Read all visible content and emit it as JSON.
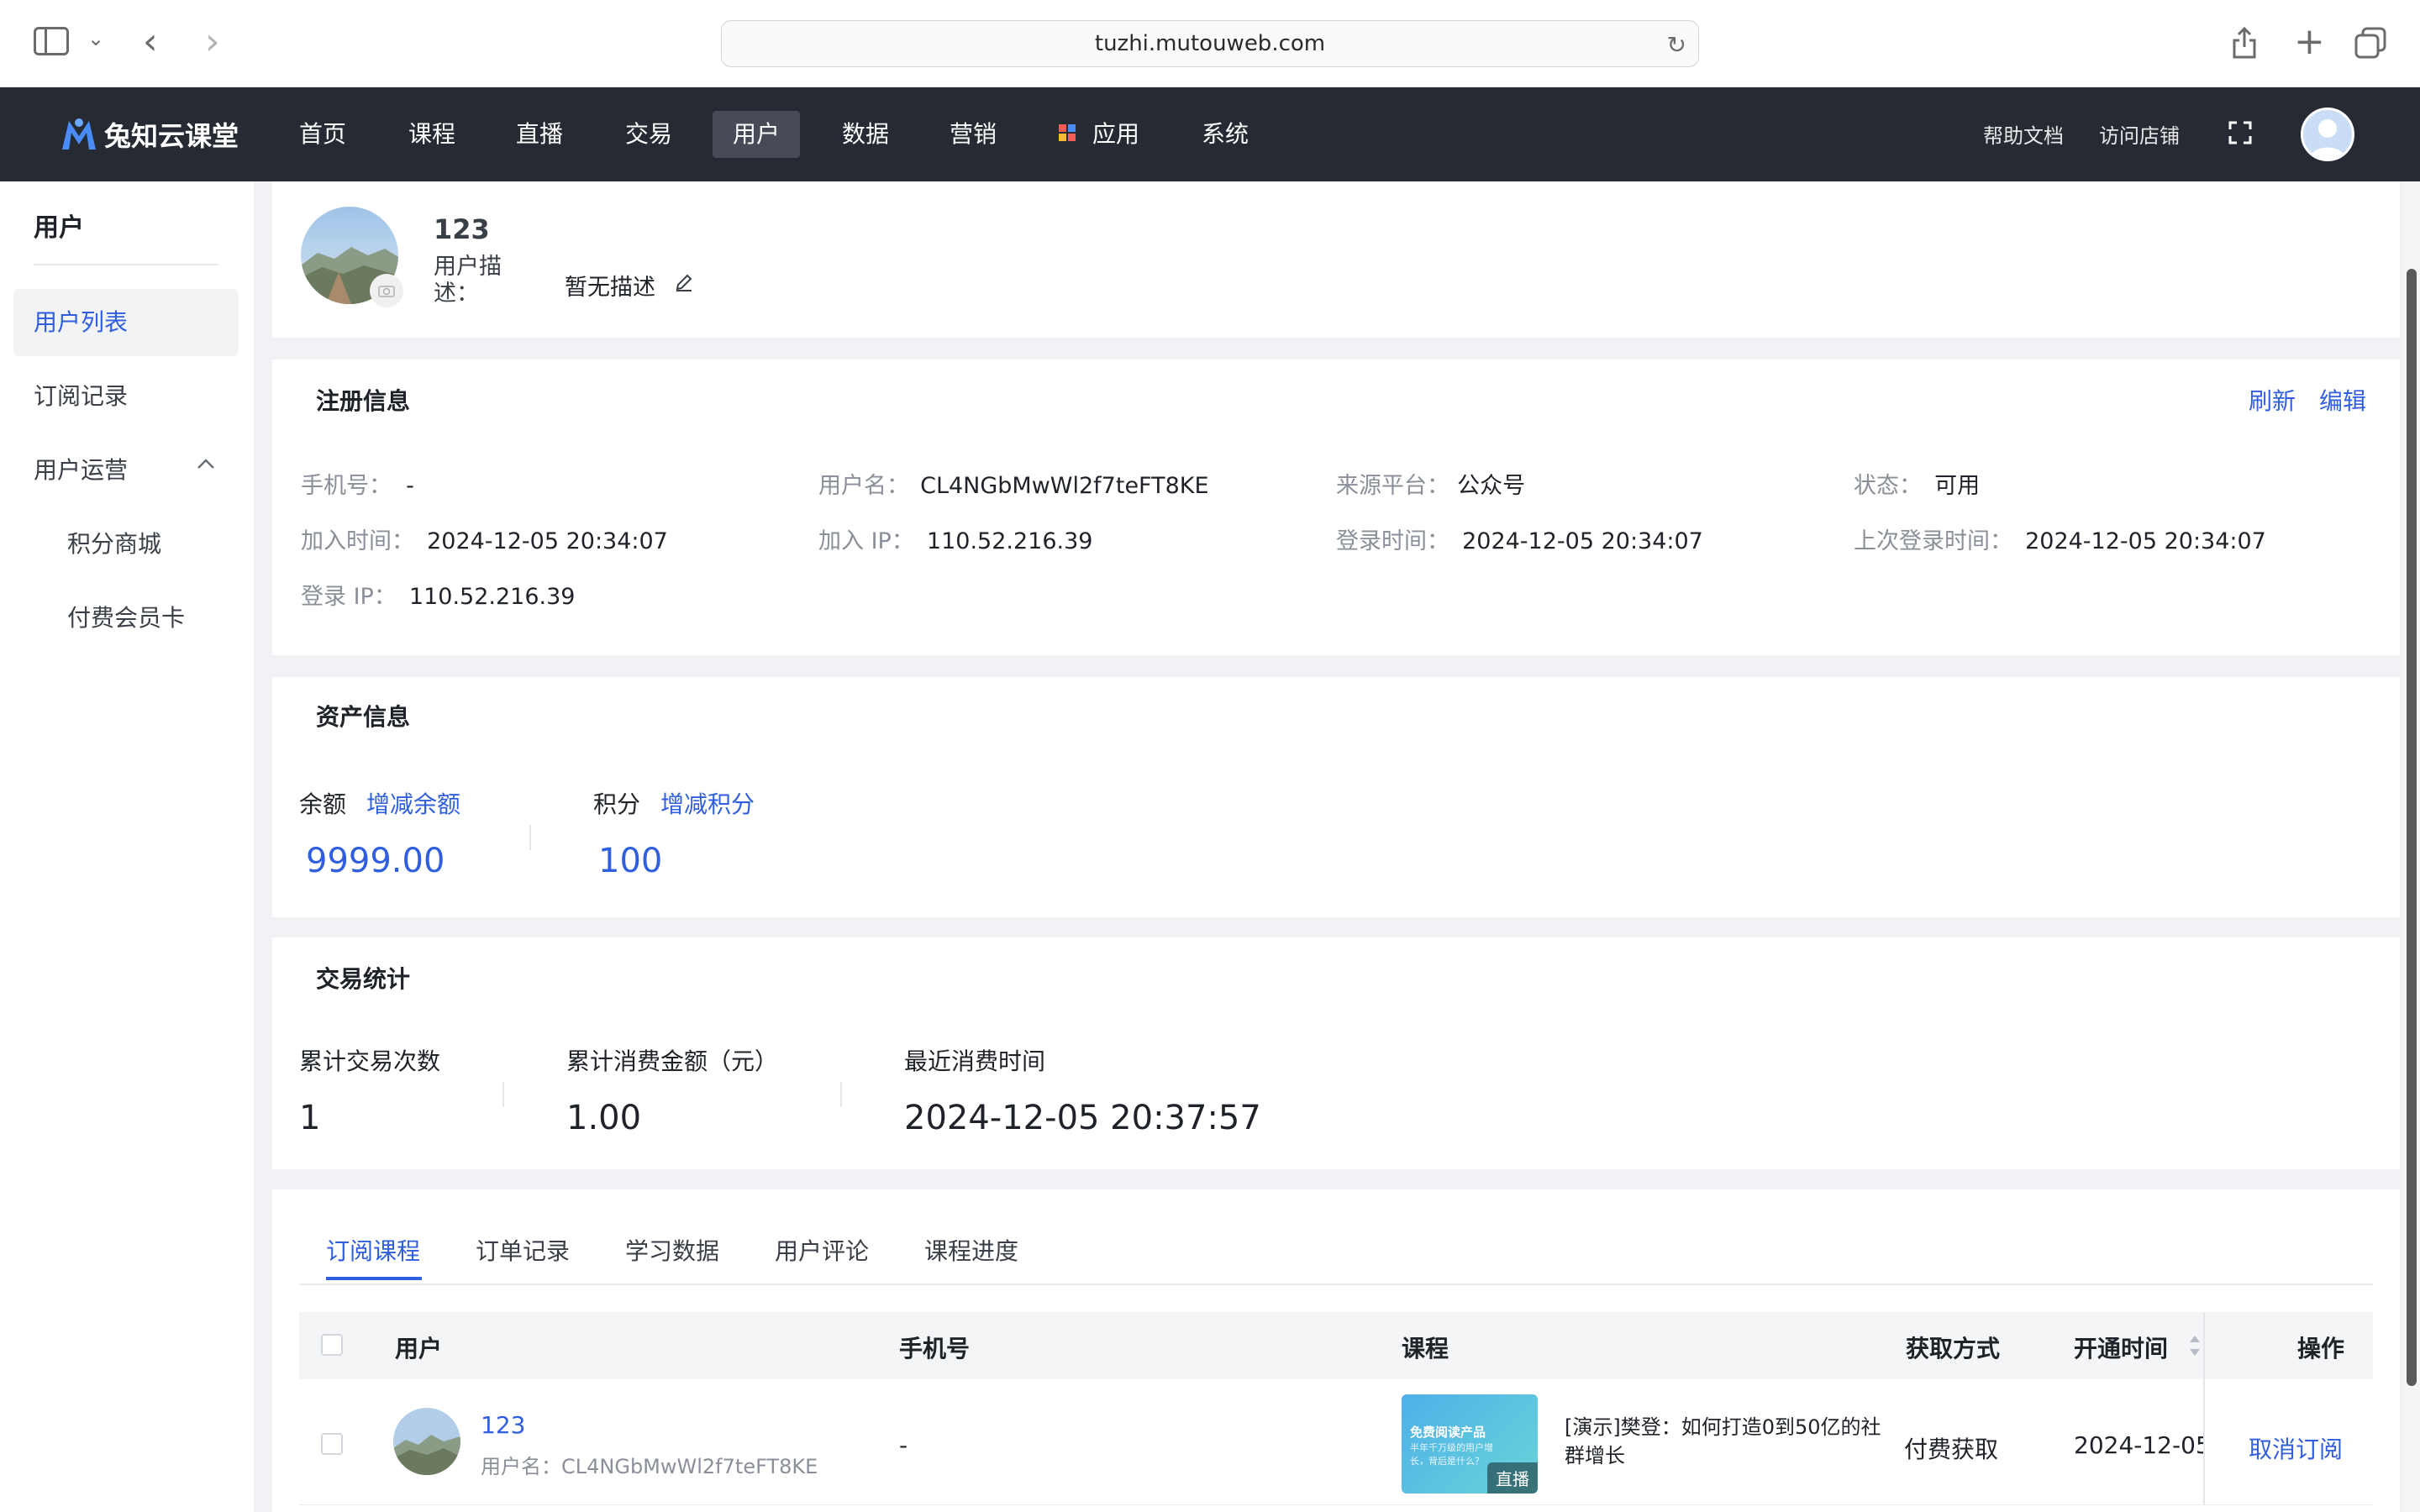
{
  "browser": {
    "url": "tuzhi.mutouweb.com"
  },
  "app": {
    "logo_text": "兔知云课堂",
    "nav": [
      "首页",
      "课程",
      "直播",
      "交易",
      "用户",
      "数据",
      "营销",
      "应用",
      "系统"
    ],
    "active_nav": "用户",
    "help_link": "帮助文档",
    "visit_store": "访问店铺"
  },
  "sidebar": {
    "title": "用户",
    "items": [
      {
        "label": "用户列表",
        "active": true
      },
      {
        "label": "订阅记录"
      },
      {
        "label": "用户运营",
        "expandable": true
      },
      {
        "label": "积分商城",
        "sub": true
      },
      {
        "label": "付费会员卡",
        "sub": true
      }
    ]
  },
  "profile": {
    "name": "123",
    "desc_label": "用户描述：",
    "desc_value": "暂无描述"
  },
  "register": {
    "title": "注册信息",
    "refresh": "刷新",
    "edit": "编辑",
    "fields": [
      {
        "label": "手机号：",
        "value": "-"
      },
      {
        "label": "用户名：",
        "value": "CL4NGbMwWl2f7teFT8KE"
      },
      {
        "label": "来源平台：",
        "value": "公众号"
      },
      {
        "label": "状态：",
        "value": "可用"
      },
      {
        "label": "加入时间：",
        "value": "2024-12-05 20:34:07"
      },
      {
        "label": "加入 IP：",
        "value": "110.52.216.39"
      },
      {
        "label": "登录时间：",
        "value": "2024-12-05 20:34:07"
      },
      {
        "label": "上次登录时间：",
        "value": "2024-12-05 20:34:07"
      },
      {
        "label": "登录 IP：",
        "value": "110.52.216.39"
      }
    ]
  },
  "assets": {
    "title": "资产信息",
    "balance_label": "余额",
    "balance_action": "增减余额",
    "balance_value": "9999.00",
    "points_label": "积分",
    "points_action": "增减积分",
    "points_value": "100"
  },
  "trade": {
    "title": "交易统计",
    "count_label": "累计交易次数",
    "count_value": "1",
    "amount_label": "累计消费金额（元）",
    "amount_value": "1.00",
    "last_label": "最近消费时间",
    "last_value": "2024-12-05 20:37:57"
  },
  "tabs": [
    "订阅课程",
    "订单记录",
    "学习数据",
    "用户评论",
    "课程进度"
  ],
  "table": {
    "headers": [
      "用户",
      "手机号",
      "课程",
      "获取方式",
      "开通时间",
      "操作"
    ],
    "rows": [
      {
        "user_name": "123",
        "user_sub": "用户名：CL4NGbMwWl2f7teFT8KE",
        "phone": "-",
        "course_thumb_title": "免费阅读产品",
        "course_thumb_sub": "半年千万级的用户增长，背后是什么？",
        "course_badge": "直播",
        "course_title": "[演示]樊登：如何打造0到50亿的社群增长",
        "method": "付费获取",
        "time": "2024-12-05",
        "action": "取消订阅"
      }
    ]
  },
  "colors": {
    "accent": "#2f5fdf",
    "header_bg": "#262a33",
    "page_bg": "#f0f2f5"
  }
}
